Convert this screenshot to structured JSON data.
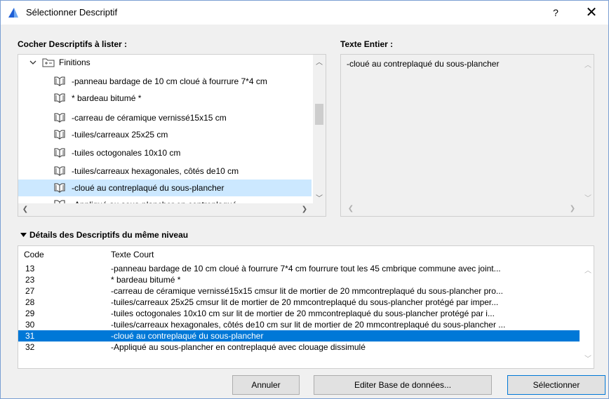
{
  "window": {
    "title": "Sélectionner Descriptif",
    "help_label": "?",
    "close_label": "✕"
  },
  "tree_panel": {
    "label": "Cocher Descriptifs à lister :",
    "parent": "Finitions",
    "items": [
      "-panneau bardage de 10 cm cloué à fourrure 7*4 cm",
      "* bardeau bitumé *",
      "-carreau de céramique vernissé15x15 cm",
      "-tuiles/carreaux 25x25 cm",
      "-tuiles octogonales 10x10 cm",
      "-tuiles/carreaux hexagonales, côtés de10 cm",
      "-cloué au contreplaqué du sous-plancher",
      "-Appliqué au sous-plancher en contreplaqué"
    ],
    "selected_index": 6
  },
  "full_text_panel": {
    "label": "Texte Entier :",
    "content": "-cloué au contreplaqué du sous-plancher"
  },
  "details": {
    "toggle_label": "Détails des Descriptifs du même niveau",
    "col_code": "Code",
    "col_text": "Texte Court",
    "rows": [
      {
        "code": "13",
        "text": "-panneau bardage de 10 cm cloué à fourrure 7*4 cm fourrure tout les 45 cmbrique commune avec joint..."
      },
      {
        "code": "23",
        "text": "* bardeau bitumé *"
      },
      {
        "code": "27",
        "text": "-carreau de céramique vernissé15x15 cmsur lit de mortier de 20 mmcontreplaqué du sous-plancher pro..."
      },
      {
        "code": "28",
        "text": "-tuiles/carreaux 25x25 cmsur lit de mortier de 20 mmcontreplaqué du sous-plancher protégé par imper..."
      },
      {
        "code": "29",
        "text": "-tuiles octogonales 10x10 cm sur lit de mortier de 20 mmcontreplaqué du sous-plancher protégé par i..."
      },
      {
        "code": "30",
        "text": "-tuiles/carreaux hexagonales, côtés de10 cm sur lit de mortier de 20 mmcontreplaqué du sous-plancher ..."
      },
      {
        "code": "31",
        "text": "-cloué au contreplaqué du sous-plancher"
      },
      {
        "code": "32",
        "text": "-Appliqué au sous-plancher en contreplaqué avec clouage dissimulé"
      }
    ],
    "selected_index": 6
  },
  "buttons": {
    "cancel": "Annuler",
    "edit_db": "Editer Base de données...",
    "select": "Sélectionner"
  },
  "colors": {
    "selection_blue": "#0078d7",
    "tree_selection": "#cce8ff",
    "accent": "#1e5fd6"
  },
  "icons": {
    "app": "archicad-icon",
    "book": "book-icon",
    "folder": "folder-icon"
  }
}
